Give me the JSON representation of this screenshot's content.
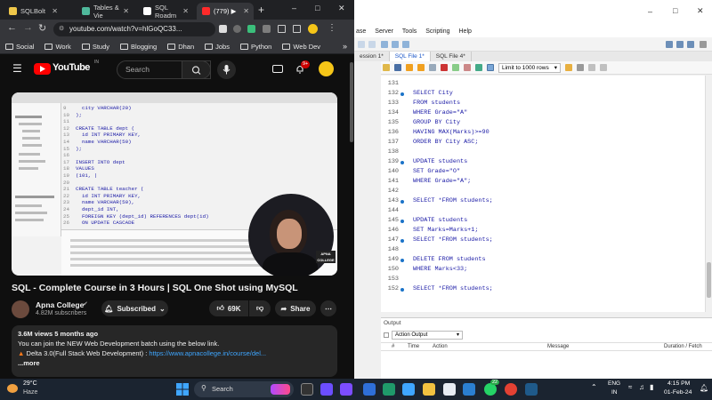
{
  "chrome": {
    "tabs": [
      {
        "label": "SQLBolt",
        "color": "#f0c84a"
      },
      {
        "label": "Tables & Vie",
        "color": "#4fb89b"
      },
      {
        "label": "SQL Roadm",
        "color": "#ffffff"
      },
      {
        "label": "(779) ▶︎",
        "color": "#ff2a2a"
      }
    ],
    "new_tab": "+",
    "url": "youtube.com/watch?v=hlGoQC33...",
    "bookmarks": [
      "Social",
      "Work",
      "Study",
      "Blogging",
      "Dhan",
      "Jobs",
      "Python",
      "Web Dev"
    ],
    "bookmarks_more": "»",
    "window_controls": [
      "–",
      "□",
      "✕"
    ]
  },
  "youtube": {
    "logo_text": "YouTube",
    "region": "IN",
    "search_placeholder": "Search",
    "notif_count": "9+",
    "video_title": "SQL - Complete Course in 3 Hours | SQL One Shot using MySQL",
    "channel": "Apna College",
    "subscribers": "4.82M subscribers",
    "subscribed_label": "Subscribed",
    "likes": "69K",
    "share_label": "Share",
    "desc_stats": "3.6M views  5 months ago",
    "desc_line1": "You can join the  NEW Web Development batch using the below link.",
    "desc_line2_prefix": "Delta 3.0(Full Stack Web Development)  : ",
    "desc_link": "https://www.apnacollege.in/course/del...",
    "desc_more": "...more",
    "thumb_badge": "APNA COLLEGE",
    "thumb_code": [
      {
        "ln": "9",
        "text": "  city VARCHAR(20)"
      },
      {
        "ln": "10",
        "text": ");"
      },
      {
        "ln": "11",
        "text": ""
      },
      {
        "ln": "12",
        "text": "CREATE TABLE dept ("
      },
      {
        "ln": "13",
        "text": "  id INT PRIMARY KEY,"
      },
      {
        "ln": "14",
        "text": "  name VARCHAR(50)"
      },
      {
        "ln": "15",
        "text": ");"
      },
      {
        "ln": "16",
        "text": ""
      },
      {
        "ln": "17",
        "text": "INSERT INTO dept"
      },
      {
        "ln": "18",
        "text": "VALUES"
      },
      {
        "ln": "19",
        "text": "(101, |"
      },
      {
        "ln": "20",
        "text": ""
      },
      {
        "ln": "21",
        "text": "CREATE TABLE teacher ("
      },
      {
        "ln": "22",
        "text": "  id INT PRIMARY KEY,"
      },
      {
        "ln": "23",
        "text": "  name VARCHAR(50),"
      },
      {
        "ln": "24",
        "text": "  dept_id INT,"
      },
      {
        "ln": "25",
        "text": "  FOREIGN KEY (dept_id) REFERENCES dept(id)"
      },
      {
        "ln": "26",
        "text": "  ON UPDATE CASCADE"
      }
    ]
  },
  "workbench": {
    "menu": [
      "ase",
      "Server",
      "Tools",
      "Scripting",
      "Help"
    ],
    "tabs": [
      "ession 1*",
      "SQL File 1*",
      "SQL File 4*"
    ],
    "limit": "Limit to 1000 rows",
    "code_lines": [
      {
        "ln": "131",
        "dot": false,
        "text": ""
      },
      {
        "ln": "132",
        "dot": true,
        "text": "SELECT City"
      },
      {
        "ln": "133",
        "dot": false,
        "text": "FROM students"
      },
      {
        "ln": "134",
        "dot": false,
        "text": "WHERE Grade=\"A\""
      },
      {
        "ln": "135",
        "dot": false,
        "text": "GROUP BY City"
      },
      {
        "ln": "136",
        "dot": false,
        "text": "HAVING MAX(Marks)>=90"
      },
      {
        "ln": "137",
        "dot": false,
        "text": "ORDER BY City ASC;"
      },
      {
        "ln": "138",
        "dot": false,
        "text": ""
      },
      {
        "ln": "139",
        "dot": true,
        "text": "UPDATE students"
      },
      {
        "ln": "140",
        "dot": false,
        "text": "SET Grade=\"O\""
      },
      {
        "ln": "141",
        "dot": false,
        "text": "WHERE Grade=\"A\";"
      },
      {
        "ln": "142",
        "dot": false,
        "text": ""
      },
      {
        "ln": "143",
        "dot": true,
        "text": "SELECT *FROM students;"
      },
      {
        "ln": "144",
        "dot": false,
        "text": ""
      },
      {
        "ln": "145",
        "dot": true,
        "text": "UPDATE students"
      },
      {
        "ln": "146",
        "dot": false,
        "text": "SET Marks=Marks+1;"
      },
      {
        "ln": "147",
        "dot": true,
        "text": "SELECT *FROM students;"
      },
      {
        "ln": "148",
        "dot": false,
        "text": ""
      },
      {
        "ln": "149",
        "dot": true,
        "text": "DELETE FROM students"
      },
      {
        "ln": "150",
        "dot": false,
        "text": "WHERE Marks<33;"
      },
      {
        "ln": "153",
        "dot": false,
        "text": ""
      },
      {
        "ln": "152",
        "dot": true,
        "text": "SELECT *FROM students;"
      }
    ],
    "output_title": "Output",
    "output_select": "Action Output",
    "output_columns": [
      "#",
      "Time",
      "Action",
      "Message",
      "Duration / Fetch"
    ]
  },
  "taskbar": {
    "temp": "29°C",
    "weather": "Haze",
    "search": "Search",
    "lang_top": "ENG",
    "lang_bottom": "IN",
    "time": "4:15 PM",
    "date": "01-Feb-24",
    "badge": "22"
  }
}
